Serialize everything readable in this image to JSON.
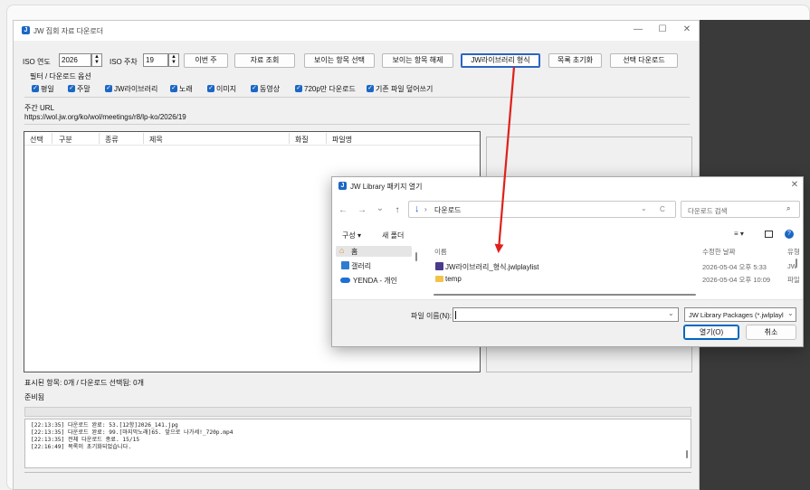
{
  "app": {
    "title": "JW 집회 자료 다운로더",
    "icon_letter": "J",
    "win_controls": [
      "—",
      "☐",
      "✕"
    ]
  },
  "toolbar": {
    "year_label": "ISO 연도",
    "year_value": "2026",
    "week_label": "ISO 주차",
    "week_value": "19",
    "buttons": {
      "this_week": "이번 주",
      "lookup": "자료 조회",
      "select_visible": "보이는 항목 선택",
      "deselect_visible": "보이는 항목 해제",
      "jwlib_format": "JW라이브러리 형식",
      "reset_list": "목록 초기화",
      "download_selected": "선택 다운로드"
    }
  },
  "filters": {
    "title": "필터 / 다운로드 옵션",
    "items": [
      "평일",
      "주말",
      "JW라이브러리",
      "노래",
      "이미지",
      "동영상",
      "720p만 다운로드",
      "기존 파일 덮어쓰기"
    ]
  },
  "url": {
    "label": "주간 URL",
    "value": "https://wol.jw.org/ko/wol/meetings/r8/lp-ko/2026/19"
  },
  "table": {
    "columns": [
      "선택",
      "구분",
      "종류",
      "제목",
      "화질",
      "파일명"
    ]
  },
  "status": {
    "count": "표시된 항목: 0개 / 다운로드 선택됨: 0개",
    "state": "준비됨"
  },
  "log": [
    "[22:13:35] 다운로드 완료: 53.[12항]2026_141.jpg",
    "[22:13:35] 다운로드 완료: 99.[마지막노래]65. 앞으로 나가세!_720p.mp4",
    "[22:13:35] 전체 다운로드 종료. 15/15",
    "[22:16:49] 목록이 초기화되었습니다."
  ],
  "dialog": {
    "title": "JW Library 패키지 열기",
    "nav": {
      "back": "←",
      "forward": "→",
      "down": "⌄",
      "up": "↑",
      "refresh": "C"
    },
    "address": "다운로드",
    "search_placeholder": "다운로드 검색",
    "organize": "구성 ▾",
    "new_folder": "새 폴더",
    "nav_items": [
      "홈",
      "갤러리",
      "YENDA - 개인"
    ],
    "columns": {
      "name": "이름",
      "modified": "수정한 날짜",
      "type": "유형"
    },
    "files": [
      {
        "name": "JW라이브러리_형식.jwlplaylist",
        "date": "2026-05-04 오후 5:33",
        "type": "JW"
      },
      {
        "name": "temp",
        "date": "2026-05-04 오후 10:09",
        "type": "파일"
      }
    ],
    "filename_label": "파일 이름(N):",
    "filename_value": "",
    "filter": "JW Library Packages (*.jwlplayl",
    "open_button": "열기(O)",
    "cancel_button": "취소"
  },
  "colors": {
    "accent": "#1b67c4",
    "arrow": "#e0201b"
  }
}
